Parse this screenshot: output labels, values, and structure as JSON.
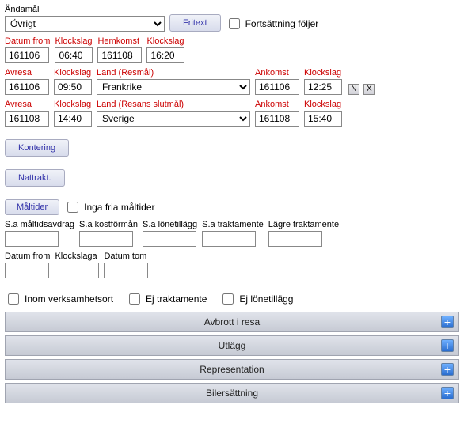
{
  "andamal": {
    "label": "Ändamål",
    "value": "Övrigt"
  },
  "fritext_btn": "Fritext",
  "fortsattning": {
    "label": "Fortsättning följer"
  },
  "main_dates": {
    "datum_from": {
      "label": "Datum from",
      "value": "161106"
    },
    "klockslag1": {
      "label": "Klockslag",
      "value": "06:40"
    },
    "hemkomst": {
      "label": "Hemkomst",
      "value": "161108"
    },
    "klockslag2": {
      "label": "Klockslag",
      "value": "16:20"
    }
  },
  "leg1": {
    "avresa": {
      "label": "Avresa",
      "value": "161106"
    },
    "klockslag": {
      "label": "Klockslag",
      "value": "09:50"
    },
    "land": {
      "label": "Land (Resmål)",
      "value": "Frankrike"
    },
    "ankomst": {
      "label": "Ankomst",
      "value": "161106"
    },
    "klockslag2": {
      "label": "Klockslag",
      "value": "12:25"
    },
    "n": "N",
    "x": "X"
  },
  "leg2": {
    "avresa": {
      "label": "Avresa",
      "value": "161108"
    },
    "klockslag": {
      "label": "Klockslag",
      "value": "14:40"
    },
    "land": {
      "label": "Land (Resans slutmål)",
      "value": "Sverige"
    },
    "ankomst": {
      "label": "Ankomst",
      "value": "161108"
    },
    "klockslag2": {
      "label": "Klockslag",
      "value": "15:40"
    }
  },
  "kontering_btn": "Kontering",
  "nattrakt_btn": "Nattrakt.",
  "maltider_btn": "Måltider",
  "inga_fria": {
    "label": "Inga fria måltider"
  },
  "sums": {
    "maltidsavdrag": {
      "label": "S.a måltidsavdrag",
      "value": ""
    },
    "kostforman": {
      "label": "S.a kostförmån",
      "value": ""
    },
    "lonetillagg": {
      "label": "S.a lönetillägg",
      "value": ""
    },
    "traktamente": {
      "label": "S.a traktamente",
      "value": ""
    },
    "lagre": {
      "label": "Lägre traktamente",
      "value": ""
    }
  },
  "dates2": {
    "datum_from": {
      "label": "Datum from",
      "value": ""
    },
    "klockslaga": {
      "label": "Klockslaga",
      "value": ""
    },
    "datum_tom": {
      "label": "Datum tom",
      "value": ""
    }
  },
  "checks": {
    "inom": "Inom verksamhetsort",
    "ej_trakt": "Ej traktamente",
    "ej_lone": "Ej lönetillägg"
  },
  "bars": {
    "avbrott": "Avbrott i resa",
    "utlagg": "Utlägg",
    "representation": "Representation",
    "bilers": "Bilersättning"
  }
}
